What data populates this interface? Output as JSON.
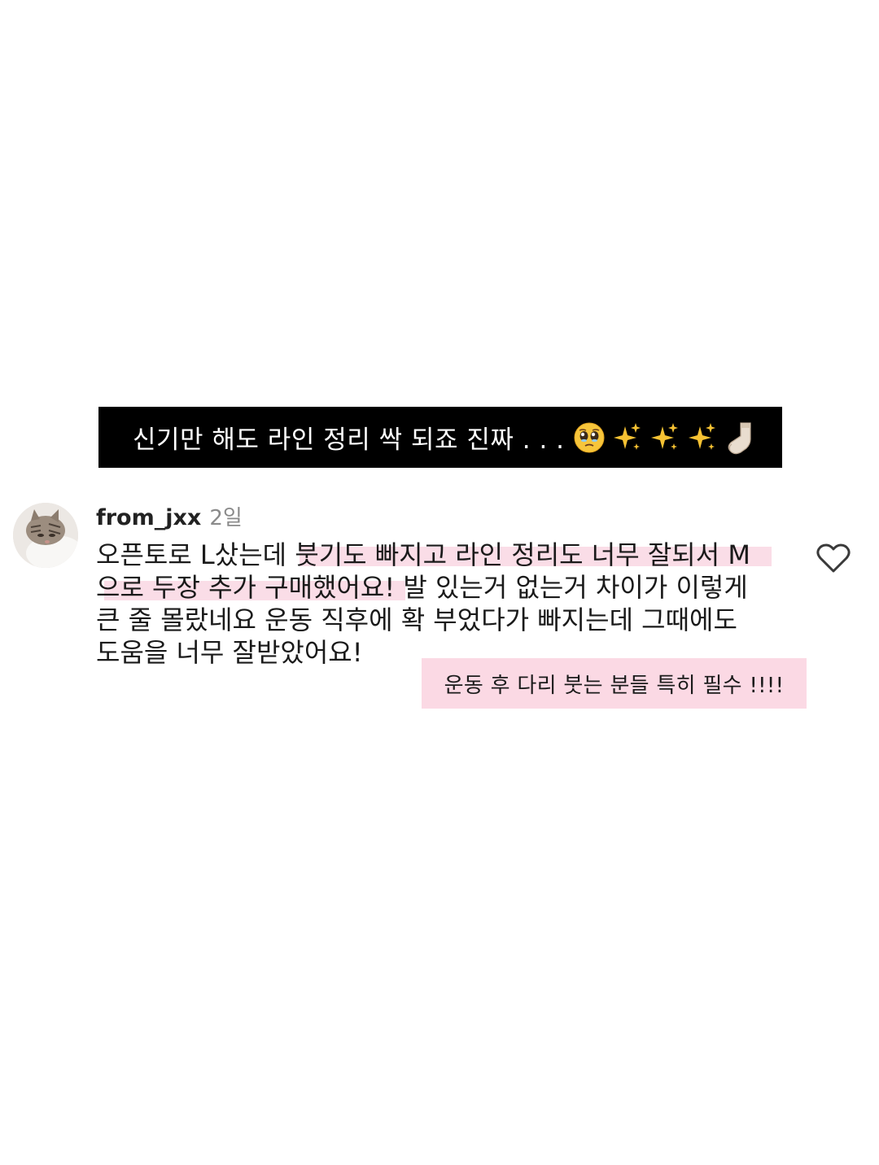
{
  "caption": {
    "text": "신기만 해도 라인 정리 싹 되죠 진짜 . . .",
    "emojis": [
      "pleading-face-icon",
      "sparkles-icon",
      "sparkles-icon",
      "sparkles-icon",
      "sock-icon"
    ]
  },
  "comment": {
    "username": "from_jxx",
    "time": "2일",
    "lines": [
      "오픈토로 L샀는데 붓기도 빠지고 라인 정리도 너무 잘되서 M",
      "으로 두장 추가 구매했어요! 발 있는거 없는거 차이가 이렇게",
      "큰 줄 몰랐네요 운동 직후에 확 부었다가 빠지는데 그때에도",
      "도움을 너무 잘받았어요!"
    ],
    "like_icon": "heart-outline-icon"
  },
  "note": {
    "text": "운동 후 다리 붓는 분들 특히 필수 !!!!"
  },
  "colors": {
    "banner_bg": "#000000",
    "highlight": "#f9d7e3",
    "note_bg": "#fbd9e4",
    "timestamp": "#8a8a8a"
  }
}
